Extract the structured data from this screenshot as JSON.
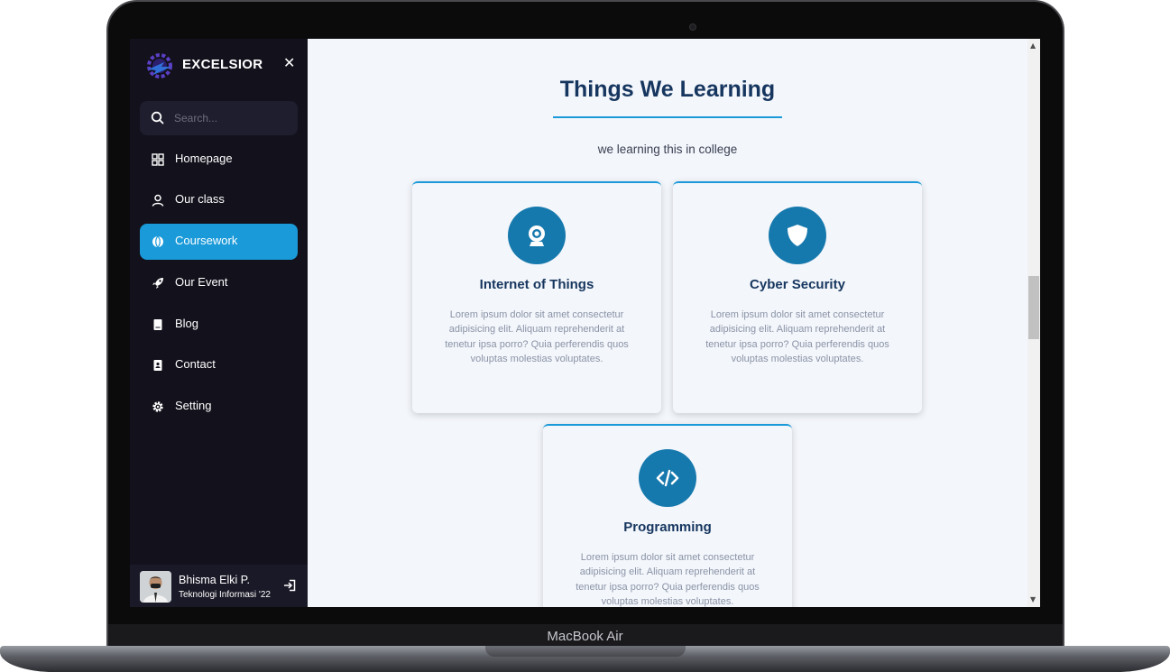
{
  "device": {
    "label": "MacBook Air"
  },
  "sidebar": {
    "brand": "EXCELSIOR",
    "close_icon": "close-icon",
    "search": {
      "placeholder": "Search...",
      "value": ""
    },
    "items": [
      {
        "label": "Homepage",
        "icon": "grid-icon",
        "active": false
      },
      {
        "label": "Our class",
        "icon": "user-icon",
        "active": false
      },
      {
        "label": "Coursework",
        "icon": "globe-icon",
        "active": true
      },
      {
        "label": "Our Event",
        "icon": "rocket-icon",
        "active": false
      },
      {
        "label": "Blog",
        "icon": "book-icon",
        "active": false
      },
      {
        "label": "Contact",
        "icon": "contact-icon",
        "active": false
      },
      {
        "label": "Setting",
        "icon": "gear-icon",
        "active": false
      }
    ],
    "profile": {
      "name": "Bhisma Elki P.",
      "role": "Teknologi Informasi '22"
    }
  },
  "main": {
    "title": "Things We Learning",
    "subtitle": "we learning this in college",
    "cards": [
      {
        "title": "Internet of Things",
        "icon": "webcam-icon",
        "text": "Lorem ipsum dolor sit amet consectetur adipisicing elit. Aliquam reprehenderit at tenetur ipsa porro? Quia perferendis quos voluptas molestias voluptates."
      },
      {
        "title": "Cyber Security",
        "icon": "shield-icon",
        "text": "Lorem ipsum dolor sit amet consectetur adipisicing elit. Aliquam reprehenderit at tenetur ipsa porro? Quia perferendis quos voluptas molestias voluptates."
      },
      {
        "title": "Programming",
        "icon": "code-icon",
        "text": "Lorem ipsum dolor sit amet consectetur adipisicing elit. Aliquam reprehenderit at tenetur ipsa porro? Quia perferendis quos voluptas molestias voluptates."
      }
    ]
  },
  "colors": {
    "accent": "#1a9ad9",
    "sidebar_bg": "#12111c",
    "heading": "#16365f",
    "icon_circle": "#1679ad"
  }
}
